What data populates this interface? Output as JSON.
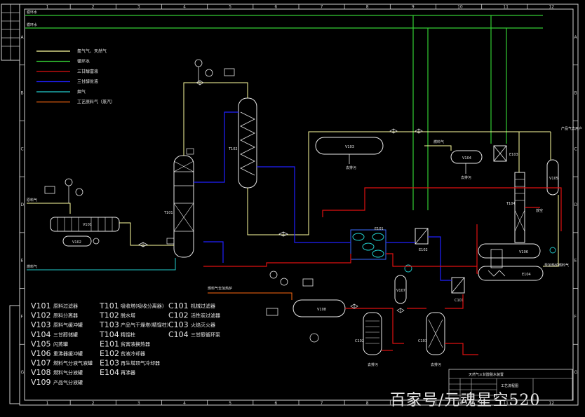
{
  "border": {
    "top_cols": [
      "1",
      "2",
      "3",
      "4",
      "5",
      "6",
      "7",
      "8",
      "9",
      "10",
      "11",
      "12"
    ],
    "bottom_cols": [
      "1",
      "2",
      "3",
      "4",
      "5",
      "6",
      "7",
      "8",
      "9",
      "10",
      "11",
      "12"
    ],
    "left_rows": [
      "A",
      "B",
      "C",
      "D",
      "E",
      "F",
      "G"
    ],
    "right_rows": [
      "A",
      "B",
      "C",
      "D",
      "E",
      "F",
      "G"
    ]
  },
  "legend": [
    {
      "label": "氮气气、天然气",
      "color": "#ffffa0"
    },
    {
      "label": "循环水",
      "color": "#33cc33"
    },
    {
      "label": "三甘醇富液",
      "color": "#e01010"
    },
    {
      "label": "三甘醇贫液",
      "color": "#2020ff"
    },
    {
      "label": "烟气",
      "color": "#22cccc"
    },
    {
      "label": "工艺原料气（蒸汽）",
      "color": "#ff6a10"
    }
  ],
  "equipment_list": [
    {
      "code": "V101",
      "name": "原料过滤器"
    },
    {
      "code": "V102",
      "name": "原料分离器"
    },
    {
      "code": "V103",
      "name": "原料气缓冲罐"
    },
    {
      "code": "V104",
      "name": "三甘醇储罐"
    },
    {
      "code": "V105",
      "name": "闪蒸罐"
    },
    {
      "code": "V106",
      "name": "重沸器缓冲罐"
    },
    {
      "code": "V107",
      "name": "燃料气分液气液罐"
    },
    {
      "code": "V108",
      "name": "燃料气分液罐"
    },
    {
      "code": "V109",
      "name": "产品气分液罐"
    },
    {
      "code": "T101",
      "name": "吸收塔(吸收分离器)"
    },
    {
      "code": "T102",
      "name": "脱水塔"
    },
    {
      "code": "T103",
      "name": "产品气干燥塔(精馏柱)"
    },
    {
      "code": "T104",
      "name": "精馏柱"
    },
    {
      "code": "E101",
      "name": "贫富液换热器"
    },
    {
      "code": "E102",
      "name": "贫液冷却器"
    },
    {
      "code": "E103",
      "name": "再生塔顶气冷却器"
    },
    {
      "code": "E104",
      "name": "再沸器"
    },
    {
      "code": "C101",
      "name": "机械过滤器"
    },
    {
      "code": "C102",
      "name": "活性炭过滤器"
    },
    {
      "code": "C103",
      "name": "火焰灭火器"
    },
    {
      "code": "C104",
      "name": "三甘醇循环泵"
    }
  ],
  "tags": {
    "v101": "V101",
    "v102": "V102",
    "v103": "V103",
    "v104": "V104",
    "v105": "V105",
    "v106": "V106",
    "v107": "V107",
    "v108": "V108",
    "v109": "V109",
    "t101": "T101",
    "t102": "T102",
    "t103": "T103",
    "t104": "T104",
    "e101": "E101",
    "e102": "E102",
    "e103": "E103",
    "e104": "E104",
    "c101": "C101",
    "c102": "C102",
    "c103": "C103",
    "c104": "C104"
  },
  "flow_texts": {
    "feed_gas": "原料气",
    "fuel_gas": "燃料气",
    "product_gas": "产品气去用户",
    "fuel_to_heater": "燃料气",
    "to_drain": "去排污",
    "vent": "放空",
    "feed_from_heater": "燃料气去加热炉",
    "tower_note": "燃料气",
    "outlet_note": "至加热炉燃料气",
    "cw_in": "循环水",
    "cw_out": "循环水"
  },
  "title_block": {
    "title": "天然气三甘醇脱水装置",
    "drawing": "工艺流程图"
  },
  "watermark": "百家号/元魂星空520"
}
